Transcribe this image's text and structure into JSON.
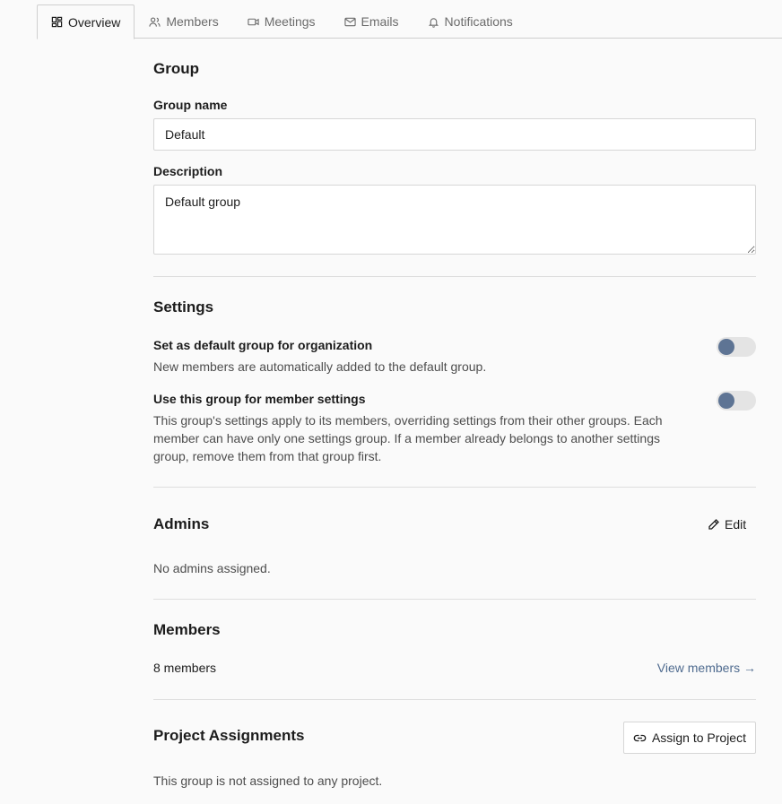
{
  "tabs": [
    {
      "label": "Overview",
      "icon": "layout-icon",
      "active": true
    },
    {
      "label": "Members",
      "icon": "users-icon"
    },
    {
      "label": "Meetings",
      "icon": "video-icon"
    },
    {
      "label": "Emails",
      "icon": "mail-icon"
    },
    {
      "label": "Notifications",
      "icon": "bell-icon"
    }
  ],
  "group": {
    "title": "Group",
    "name_label": "Group name",
    "name_value": "Default",
    "description_label": "Description",
    "description_value": "Default group"
  },
  "settings": {
    "title": "Settings",
    "default_group": {
      "label": "Set as default group for organization",
      "description": "New members are automatically added to the default group.",
      "enabled": false
    },
    "member_settings": {
      "label": "Use this group for member settings",
      "description": "This group's settings apply to its members, overriding settings from their other groups. Each member can have only one settings group. If a member already belongs to another settings group, remove them from that group first.",
      "enabled": false
    }
  },
  "admins": {
    "title": "Admins",
    "edit_label": "Edit",
    "empty_text": "No admins assigned."
  },
  "members": {
    "title": "Members",
    "count_text": "8 members",
    "view_link": "View members →"
  },
  "projects": {
    "title": "Project Assignments",
    "assign_label": "Assign to Project",
    "empty_text": "This group is not assigned to any project."
  },
  "colors": {
    "accent_link": "#4f6b8f",
    "toggle_knob": "#5e7494",
    "toggle_track": "#e4e4e4"
  }
}
